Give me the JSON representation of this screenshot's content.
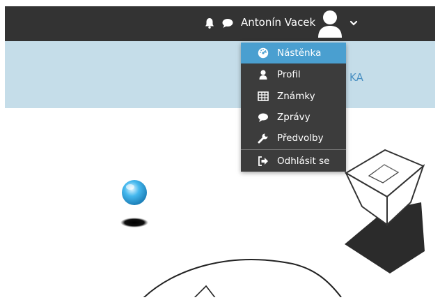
{
  "header": {
    "user_name": "Antonín Vacek",
    "icons": [
      "bell-icon",
      "chat-icon",
      "user-avatar-icon",
      "chevron-down-icon"
    ]
  },
  "banner": {
    "text": "KA"
  },
  "user_menu": {
    "items": [
      {
        "label": "Nástěnka",
        "icon": "dashboard-icon",
        "active": true
      },
      {
        "label": "Profil",
        "icon": "user-icon"
      },
      {
        "label": "Známky",
        "icon": "table-icon"
      },
      {
        "label": "Zprávy",
        "icon": "chat-icon"
      },
      {
        "label": "Předvolby",
        "icon": "wrench-icon"
      },
      {
        "label": "Odhlásit se",
        "icon": "sign-out-icon"
      }
    ]
  },
  "colors": {
    "topbar": "#333333",
    "banner": "#c5dde9",
    "menu": "#3c3c3c",
    "menu_active": "#4a9fd0",
    "banner_text": "#4a90c2"
  }
}
